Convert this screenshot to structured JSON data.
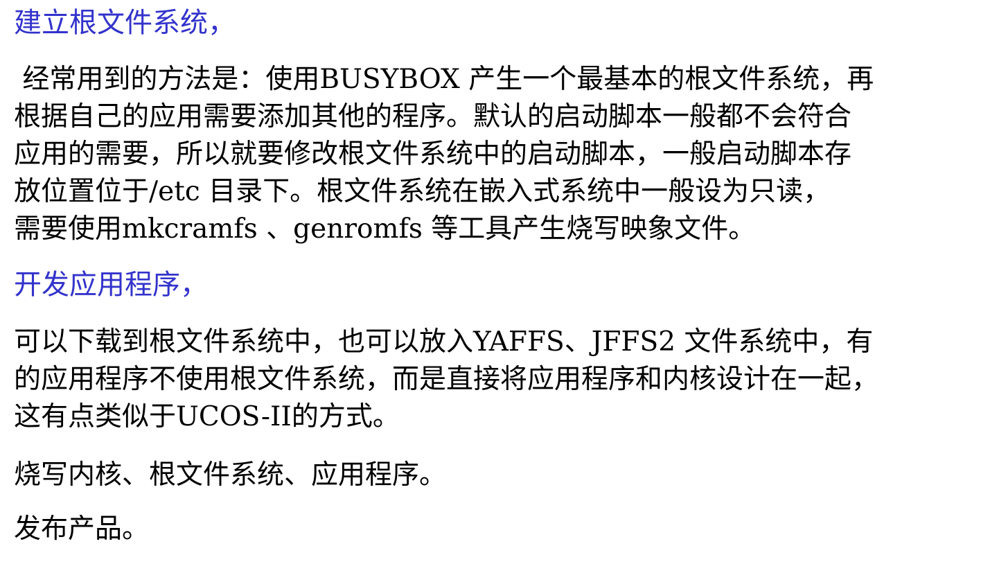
{
  "section1": {
    "heading": "建立根文件系统，",
    "lines": [
      " 经常用到的方法是：使用BUSYBOX 产生一个最基本的根文件系统，再",
      "根据自己的应用需要添加其他的程序。默认的启动脚本一般都不会符合",
      "应用的需要，所以就要修改根文件系统中的启动脚本，一般启动脚本存",
      "放位置位于/etc 目录下。根文件系统在嵌入式系统中一般设为只读，",
      "需要使用mkcramfs 、genromfs 等工具产生烧写映象文件。"
    ]
  },
  "section2": {
    "heading": "开发应用程序，",
    "lines": [
      "可以下载到根文件系统中，也可以放入YAFFS、JFFS2 文件系统中，有",
      "的应用程序不使用根文件系统，而是直接将应用程序和内核设计在一起，",
      "这有点类似于UCOS-II的方式。"
    ]
  },
  "section3": {
    "text": "烧写内核、根文件系统、应用程序。"
  },
  "section4": {
    "text": "发布产品。"
  },
  "colors": {
    "heading": "#3333cc",
    "body": "#000000",
    "background": "#ffffff"
  }
}
